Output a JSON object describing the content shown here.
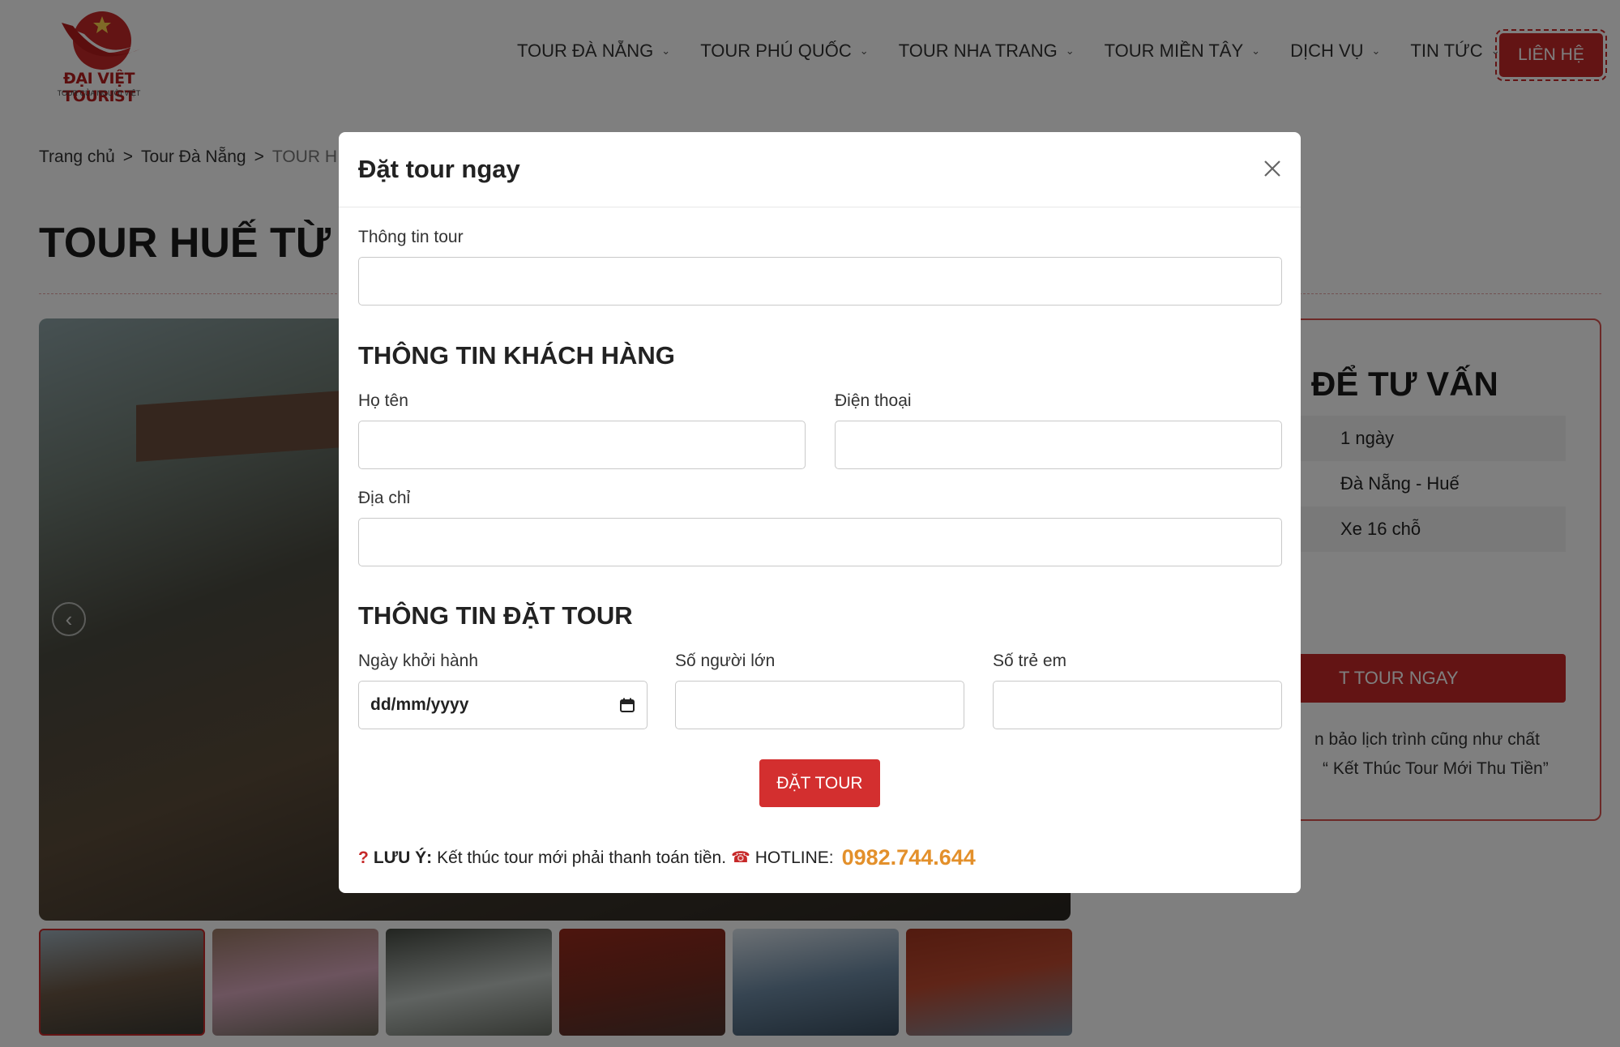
{
  "header": {
    "logo_text": "ĐẠI VIỆT TOURIST",
    "logo_slogan": "TOUR CỦA NGƯỜI VIỆT",
    "nav": [
      {
        "label": "TOUR ĐÀ NẴNG"
      },
      {
        "label": "TOUR PHÚ QUỐC"
      },
      {
        "label": "TOUR NHA TRANG"
      },
      {
        "label": "TOUR MIỀN TÂY"
      },
      {
        "label": "DỊCH VỤ"
      },
      {
        "label": "TIN TỨC"
      }
    ],
    "contact_label": "LIÊN HỆ"
  },
  "breadcrumb": {
    "home": "Trang chủ",
    "category": "Tour Đà Nẵng",
    "current": "TOUR H",
    "separator": ">"
  },
  "page_title": "TOUR HUẾ TỪ Đ",
  "sidebar": {
    "heading": "ĐỂ TƯ VẤN",
    "rows": [
      "1 ngày",
      "Đà Nẵng - Huế",
      "Xe 16 chỗ"
    ],
    "book_button": "T TOUR NGAY",
    "note_line1": "n bảo lịch trình cũng như chất",
    "note_line2": "“ Kết Thúc Tour Mới Thu Tiền”"
  },
  "modal": {
    "title": "Đặt tour ngay",
    "tour_info_label": "Thông tin tour",
    "tour_info_value": "",
    "customer_section": "THÔNG TIN KHÁCH HÀNG",
    "name_label": "Họ tên",
    "name_value": "",
    "phone_label": "Điện thoại",
    "phone_value": "",
    "address_label": "Địa chỉ",
    "address_value": "",
    "booking_section": "THÔNG TIN ĐẶT TOUR",
    "date_label": "Ngày khởi hành",
    "date_placeholder": "dd/mm/yyyy",
    "adults_label": "Số người lớn",
    "adults_value": "",
    "children_label": "Số trẻ em",
    "children_value": "",
    "submit_label": "ĐẶT TOUR",
    "note_mark": "?",
    "note_prefix": "LƯU Ý:",
    "note_text": "Kết thúc tour mới phải thanh toán tiền.",
    "hotline_icon": "☎",
    "hotline_label": "HOTLINE:",
    "hotline_number": "0982.744.644"
  },
  "colors": {
    "brand_red": "#c62828",
    "hotline_orange": "#e3902b",
    "overlay": "rgba(0,0,0,0.5)"
  }
}
